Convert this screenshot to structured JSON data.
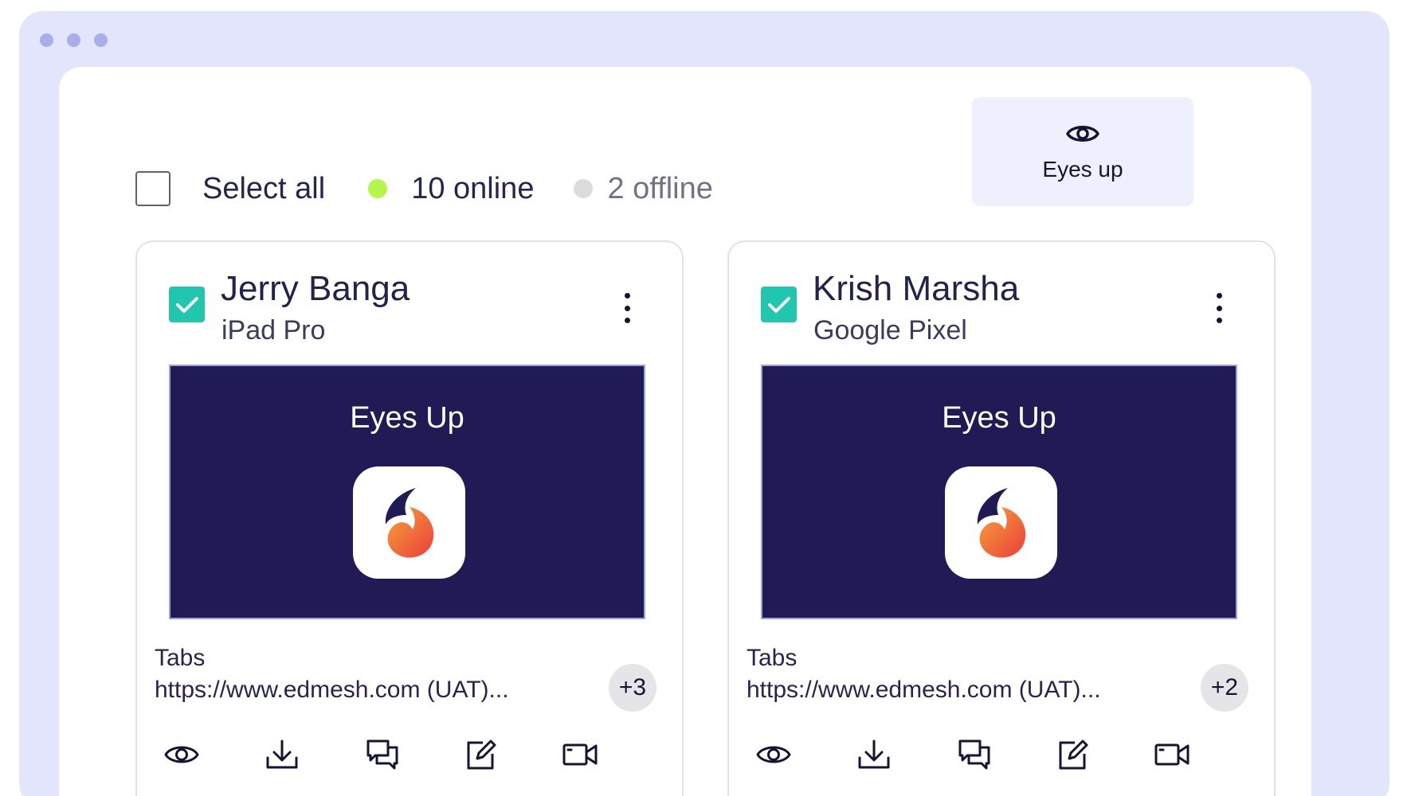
{
  "toolbar": {
    "select_all_label": "Select all",
    "online_text": "10 online",
    "offline_text": "2 offline"
  },
  "eyes_up_button": {
    "label": "Eyes up",
    "icon": "eye-icon"
  },
  "colors": {
    "online": "#b4f748",
    "offline": "#dcdcdc",
    "checked": "#20c7ae",
    "screen_bg": "#201a55",
    "window_bg": "#e3e5fd"
  },
  "devices": [
    {
      "name": "Jerry Banga",
      "device": "iPad Pro",
      "checked": true,
      "screen_title": "Eyes Up",
      "tabs_label": "Tabs",
      "tab_url": "https://www.edmesh.com (UAT)...",
      "more_tabs": "+3"
    },
    {
      "name": "Krish Marsha",
      "device": "Google Pixel",
      "checked": true,
      "screen_title": "Eyes Up",
      "tabs_label": "Tabs",
      "tab_url": "https://www.edmesh.com (UAT)...",
      "more_tabs": "+2"
    }
  ],
  "card_actions": [
    "eye-icon",
    "download-icon",
    "chat-icon",
    "edit-icon",
    "video-camera-icon"
  ]
}
